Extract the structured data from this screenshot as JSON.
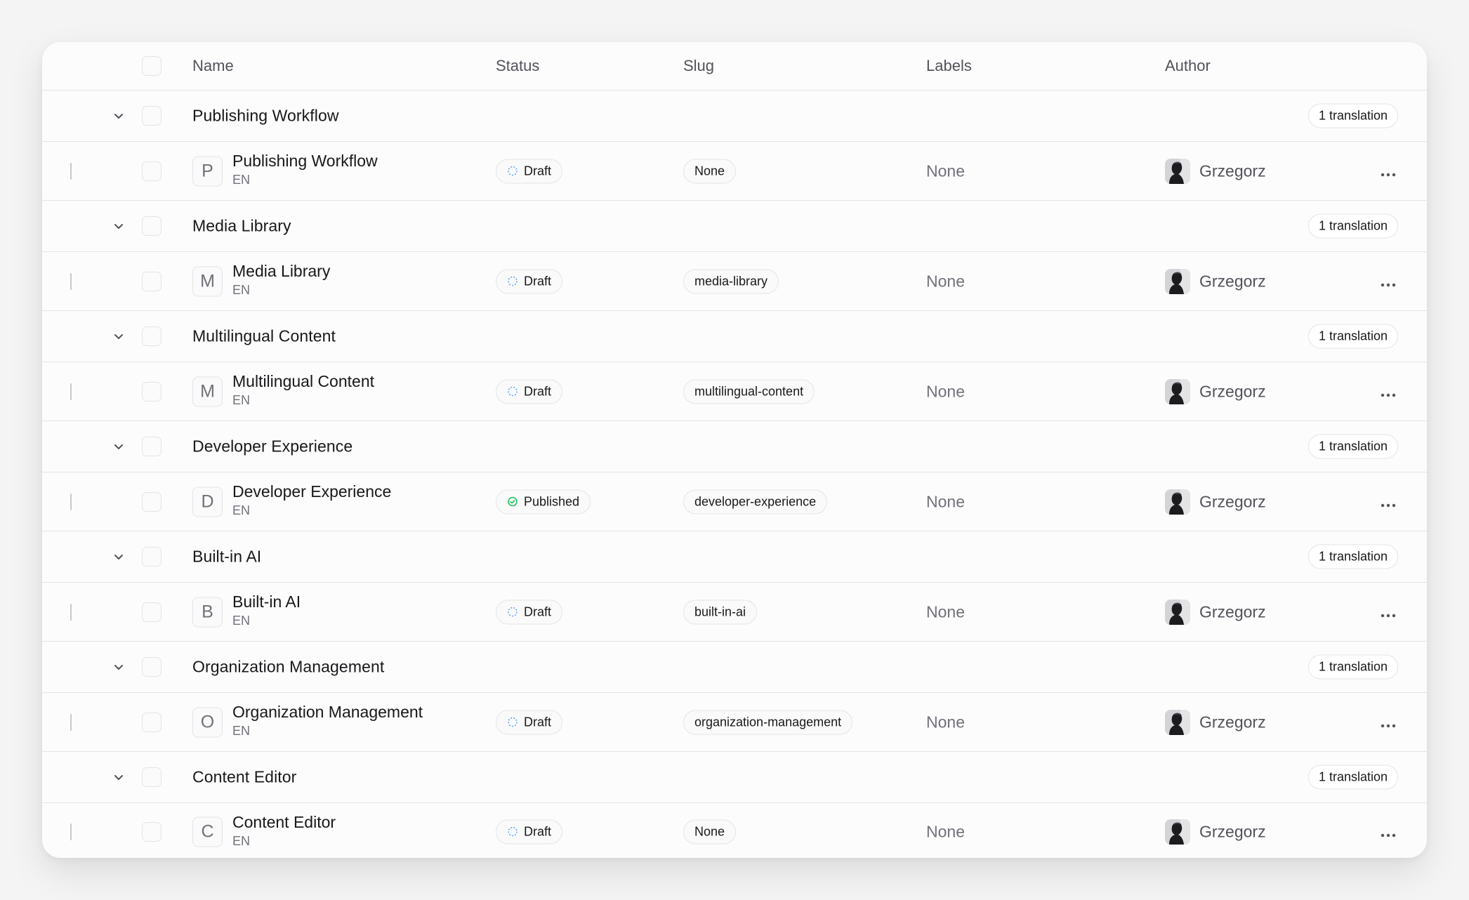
{
  "columns": {
    "name": "Name",
    "status": "Status",
    "slug": "Slug",
    "labels": "Labels",
    "author": "Author"
  },
  "colors": {
    "draft_icon": "#60a5fa",
    "published_icon": "#22c55e",
    "border": "#e4e4e7"
  },
  "groups": [
    {
      "title": "Publishing Workflow",
      "translations": "1 translation",
      "entry": {
        "letter": "P",
        "name": "Publishing Workflow",
        "locale": "EN",
        "status": "Draft",
        "status_type": "draft",
        "slug": "None",
        "labels": "None",
        "author": "Grzegorz"
      }
    },
    {
      "title": "Media Library",
      "translations": "1 translation",
      "entry": {
        "letter": "M",
        "name": "Media Library",
        "locale": "EN",
        "status": "Draft",
        "status_type": "draft",
        "slug": "media-library",
        "labels": "None",
        "author": "Grzegorz"
      }
    },
    {
      "title": "Multilingual Content",
      "translations": "1 translation",
      "entry": {
        "letter": "M",
        "name": "Multilingual Content",
        "locale": "EN",
        "status": "Draft",
        "status_type": "draft",
        "slug": "multilingual-content",
        "labels": "None",
        "author": "Grzegorz"
      }
    },
    {
      "title": "Developer Experience",
      "translations": "1 translation",
      "entry": {
        "letter": "D",
        "name": "Developer Experience",
        "locale": "EN",
        "status": "Published",
        "status_type": "published",
        "slug": "developer-experience",
        "labels": "None",
        "author": "Grzegorz"
      }
    },
    {
      "title": "Built-in AI",
      "translations": "1 translation",
      "entry": {
        "letter": "B",
        "name": "Built-in AI",
        "locale": "EN",
        "status": "Draft",
        "status_type": "draft",
        "slug": "built-in-ai",
        "labels": "None",
        "author": "Grzegorz"
      }
    },
    {
      "title": "Organization Management",
      "translations": "1 translation",
      "entry": {
        "letter": "O",
        "name": "Organization Management",
        "locale": "EN",
        "status": "Draft",
        "status_type": "draft",
        "slug": "organization-management",
        "labels": "None",
        "author": "Grzegorz"
      }
    },
    {
      "title": "Content Editor",
      "translations": "1 translation",
      "entry": {
        "letter": "C",
        "name": "Content Editor",
        "locale": "EN",
        "status": "Draft",
        "status_type": "draft",
        "slug": "None",
        "labels": "None",
        "author": "Grzegorz"
      }
    }
  ]
}
